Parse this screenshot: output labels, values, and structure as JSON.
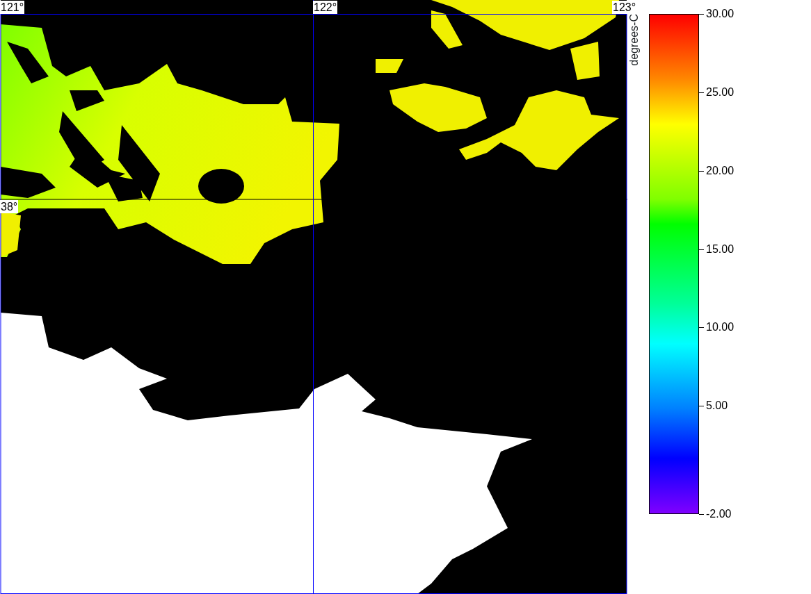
{
  "map": {
    "longitude_labels": [
      "121°",
      "122°",
      "123°"
    ],
    "latitude_labels": [
      "38°"
    ]
  },
  "colorbar": {
    "label": "degrees-C",
    "ticks": [
      "30.00",
      "25.00",
      "20.00",
      "15.00",
      "10.00",
      "5.00",
      "-2.00"
    ]
  }
}
